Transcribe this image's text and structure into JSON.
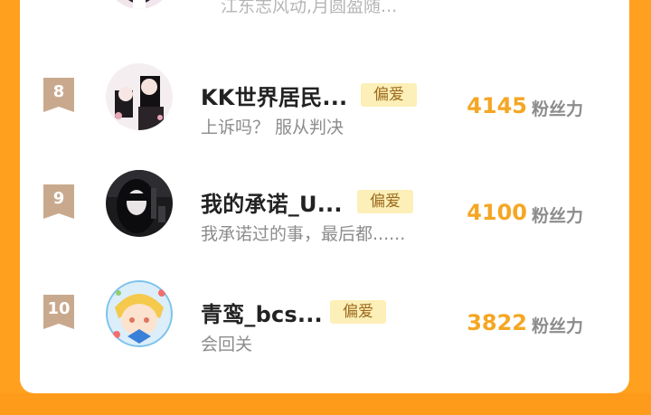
{
  "top_partial": {
    "bio": "江东志风动,月圆盈随..."
  },
  "entries": [
    {
      "rank": "8",
      "name": "KK世界居民...",
      "tag": "偏爱",
      "bio": "上诉吗？ 服从判决",
      "fans": "4145",
      "fans_label": "粉丝力",
      "avatar_icon": "anime-duo-avatar"
    },
    {
      "rank": "9",
      "name": "我的承诺_U...",
      "tag": "偏爱",
      "bio": "我承诺过的事，最后都......",
      "fans": "4100",
      "fans_label": "粉丝力",
      "avatar_icon": "anime-dark-girl-avatar"
    },
    {
      "rank": "10",
      "name": "青鸾_bcs...",
      "tag": "偏爱",
      "bio": "会回关",
      "fans": "3822",
      "fans_label": "粉丝力",
      "avatar_icon": "anime-blonde-boy-avatar"
    }
  ],
  "colors": {
    "page_bg": "#ffa11f",
    "fans_number": "#f5a623",
    "tag_bg": "#fcefb7",
    "badge": "#c9a98e"
  }
}
